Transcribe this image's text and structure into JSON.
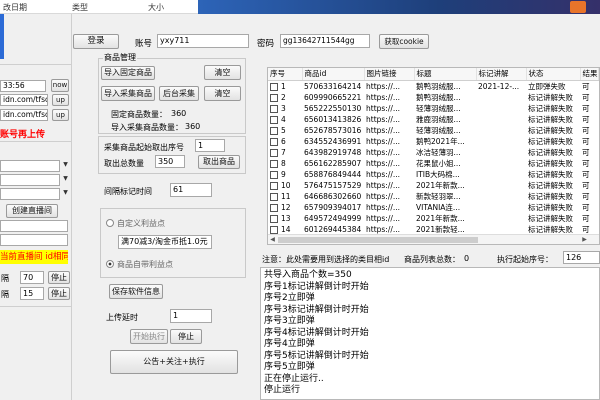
{
  "taskbar": {
    "items": [
      "改日期",
      "类型",
      "大小"
    ]
  },
  "left": {
    "time_value": "33:56",
    "time_btn": "now",
    "url1": "idn.com/tfsc",
    "url1_btn": "up",
    "url2": "idn.com/tfsc",
    "url2_btn": "up",
    "red_text": "账号再上传",
    "create_live_button": "创建直播间",
    "yellow_text": "当前直播间 id相同",
    "interval1_label": "隔",
    "interval1_value": "70",
    "interval1_btn": "停止",
    "interval2_label": "隔",
    "interval2_value": "15",
    "interval2_btn": "停止"
  },
  "topbar": {
    "login_button": "登录",
    "account_label": "账号",
    "account_value": "yxy711",
    "password_label": "密码",
    "password_value": "gg13642711544gg",
    "get_cookie_button": "获取cookie"
  },
  "goods": {
    "group_title": "商品管理",
    "import_fixed_button": "导入固定商品",
    "clear1_button": "清空",
    "import_collect_button": "导入采集商品",
    "backend_collect_button": "后台采集",
    "clear2_button": "清空",
    "fixed_count_label": "固定商品数量：",
    "fixed_count_value": "360",
    "import_count_label": "导入采集商品数量：",
    "import_count_value": "360",
    "start_seq_label": "采集商品起始取出序号",
    "start_seq_value": "1",
    "take_total_label": "取出总数量",
    "take_total_value": "350",
    "take_goods_button": "取出商品",
    "interval_label": "间隔标记时间",
    "interval_value": "61",
    "custom_radio_label": "自定义利益点",
    "custom_text": "满70减3/淘金币抵1.0元",
    "goods_radio_label": "商品自带利益点",
    "save_button": "保存软件信息",
    "upload_delay_label": "上传延时",
    "upload_delay_value": "1",
    "start_button": "开始执行",
    "stop_button": "停止",
    "announce_button": "公告+关注+执行"
  },
  "table": {
    "headers": [
      "序号",
      "商品id",
      "图片链接",
      "标题",
      "标记讲解",
      "状态",
      "结果"
    ],
    "rows": [
      [
        "1",
        "570633164214",
        "https://...",
        "鹅鸭羽绒服...",
        "2021-12-...",
        "立即弹失败",
        "可"
      ],
      [
        "2",
        "609990665221",
        "https://...",
        "鹅鸭羽绒服...",
        "",
        "标记讲解失败",
        "可"
      ],
      [
        "3",
        "565222550130",
        "https://...",
        "轻薄羽绒服...",
        "",
        "标记讲解失败",
        "可"
      ],
      [
        "4",
        "656013413826",
        "https://...",
        "雅鹿羽绒服...",
        "",
        "标记讲解失败",
        "可"
      ],
      [
        "5",
        "652678573016",
        "https://...",
        "轻薄羽绒服...",
        "",
        "标记讲解失败",
        "可"
      ],
      [
        "6",
        "634552436991",
        "https://...",
        "鹅鸭2021年...",
        "",
        "标记讲解失败",
        "可"
      ],
      [
        "7",
        "643982919748",
        "https://...",
        "冰洁轻薄羽...",
        "",
        "标记讲解失败",
        "可"
      ],
      [
        "8",
        "656162285907",
        "https://...",
        "花果鼠小姐...",
        "",
        "标记讲解失败",
        "可"
      ],
      [
        "9",
        "658876849444",
        "https://...",
        "ITIB大码棉...",
        "",
        "标记讲解失败",
        "可"
      ],
      [
        "10",
        "576475157529",
        "https://...",
        "2021年新款...",
        "",
        "标记讲解失败",
        "可"
      ],
      [
        "11",
        "646686302660",
        "https://...",
        "新款轻羽翠...",
        "",
        "标记讲解失败",
        "可"
      ],
      [
        "12",
        "657909394017",
        "https://...",
        "VITANIA连...",
        "",
        "标记讲解失败",
        "可"
      ],
      [
        "13",
        "649572494999",
        "https://...",
        "2021年新款...",
        "",
        "标记讲解失败",
        "可"
      ],
      [
        "14",
        "601269445384",
        "https://...",
        "2021新款轻...",
        "",
        "标记讲解失败",
        "可"
      ],
      [
        "15",
        "628360471560",
        "https://...",
        "鹅鸭羽绒服...",
        "",
        "标记讲解失败",
        "可"
      ]
    ]
  },
  "statusbar": {
    "note": "注意：此处需要用到选择的类目相id",
    "total_label": "商品列表总数：",
    "total_value": "0",
    "exec_label": "执行起始序号：",
    "exec_value": "126"
  },
  "log": {
    "lines": [
      "共导入商品个数=350",
      "序号1标记讲解倒计时开始",
      "序号2立即弹",
      "序号3标记讲解倒计时开始",
      "序号3立即弹",
      "序号4标记讲解倒计时开始",
      "序号4立即弹",
      "序号5标记讲解倒计时开始",
      "序号5立即弹",
      "正在停止运行..",
      "停止运行"
    ]
  },
  "colors": {
    "red_text": "#ff0000",
    "yellow_bg": "#ffff00",
    "taskbar_bg": "#1f4f9a",
    "accent_left": "#2c6bd6"
  }
}
